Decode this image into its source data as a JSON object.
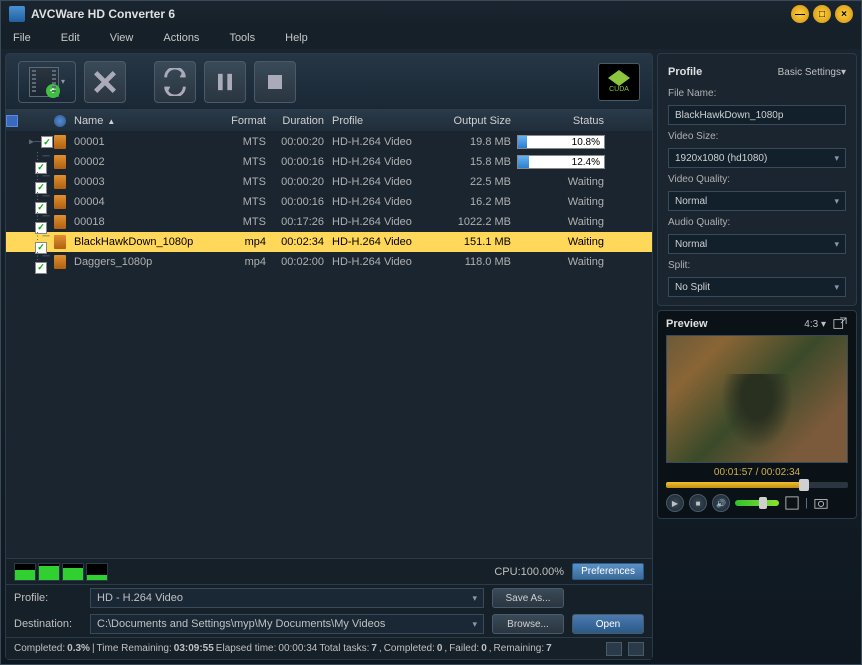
{
  "app": {
    "title": "AVCWare HD Converter 6"
  },
  "menu": [
    "File",
    "Edit",
    "View",
    "Actions",
    "Tools",
    "Help"
  ],
  "columns": {
    "name": "Name",
    "format": "Format",
    "duration": "Duration",
    "profile": "Profile",
    "outputSize": "Output Size",
    "status": "Status"
  },
  "files": [
    {
      "name": "00001",
      "format": "MTS",
      "duration": "00:00:20",
      "profile": "HD-H.264 Video",
      "size": "19.8 MB",
      "status": "progress",
      "percent": "10.8%",
      "pwidth": 10.8,
      "checked": true,
      "selected": false
    },
    {
      "name": "00002",
      "format": "MTS",
      "duration": "00:00:16",
      "profile": "HD-H.264 Video",
      "size": "15.8 MB",
      "status": "progress",
      "percent": "12.4%",
      "pwidth": 12.4,
      "checked": true,
      "selected": false
    },
    {
      "name": "00003",
      "format": "MTS",
      "duration": "00:00:20",
      "profile": "HD-H.264 Video",
      "size": "22.5 MB",
      "status": "Waiting",
      "checked": true,
      "selected": false
    },
    {
      "name": "00004",
      "format": "MTS",
      "duration": "00:00:16",
      "profile": "HD-H.264 Video",
      "size": "16.2 MB",
      "status": "Waiting",
      "checked": true,
      "selected": false
    },
    {
      "name": "00018",
      "format": "MTS",
      "duration": "00:17:26",
      "profile": "HD-H.264 Video",
      "size": "1022.2 MB",
      "status": "Waiting",
      "checked": true,
      "selected": false
    },
    {
      "name": "BlackHawkDown_1080p",
      "format": "mp4",
      "duration": "00:02:34",
      "profile": "HD-H.264 Video",
      "size": "151.1 MB",
      "status": "Waiting",
      "checked": true,
      "selected": true
    },
    {
      "name": "Daggers_1080p",
      "format": "mp4",
      "duration": "00:02:00",
      "profile": "HD-H.264 Video",
      "size": "118.0 MB",
      "status": "Waiting",
      "checked": true,
      "selected": false
    }
  ],
  "cpu": {
    "label": "CPU:100.00%",
    "preferences": "Preferences",
    "cols": [
      60,
      85,
      70,
      30
    ]
  },
  "profileRow": {
    "label": "Profile:",
    "value": "HD - H.264 Video",
    "saveAs": "Save As..."
  },
  "destRow": {
    "label": "Destination:",
    "value": "C:\\Documents and Settings\\myp\\My Documents\\My Videos",
    "browse": "Browse...",
    "open": "Open"
  },
  "statusBar": {
    "completedLabel": "Completed:",
    "completed": "0.3%",
    "timeLabel": "Time Remaining:",
    "time": "03:09:55",
    "elapsedLabel": "Elapsed time:",
    "elapsed": "00:00:34",
    "tasksLabel": "Total tasks:",
    "tasks": "7",
    "compLabel": "Completed:",
    "comp": "0",
    "failLabel": "Failed:",
    "fail": "0",
    "remainLabel": "Remaining:",
    "remain": "7"
  },
  "side": {
    "profileTitle": "Profile",
    "basicSettings": "Basic Settings▾",
    "fileNameLabel": "File Name:",
    "fileName": "BlackHawkDown_1080p",
    "videoSizeLabel": "Video Size:",
    "videoSize": "1920x1080 (hd1080)",
    "videoQualityLabel": "Video Quality:",
    "videoQuality": "Normal",
    "audioQualityLabel": "Audio Quality:",
    "audioQuality": "Normal",
    "splitLabel": "Split:",
    "split": "No Split"
  },
  "preview": {
    "title": "Preview",
    "ratio": "4:3 ▾",
    "current": "00:01:57",
    "total": "00:02:34",
    "sep": " / ",
    "seekPercent": 76
  },
  "cuda": "CUDA"
}
